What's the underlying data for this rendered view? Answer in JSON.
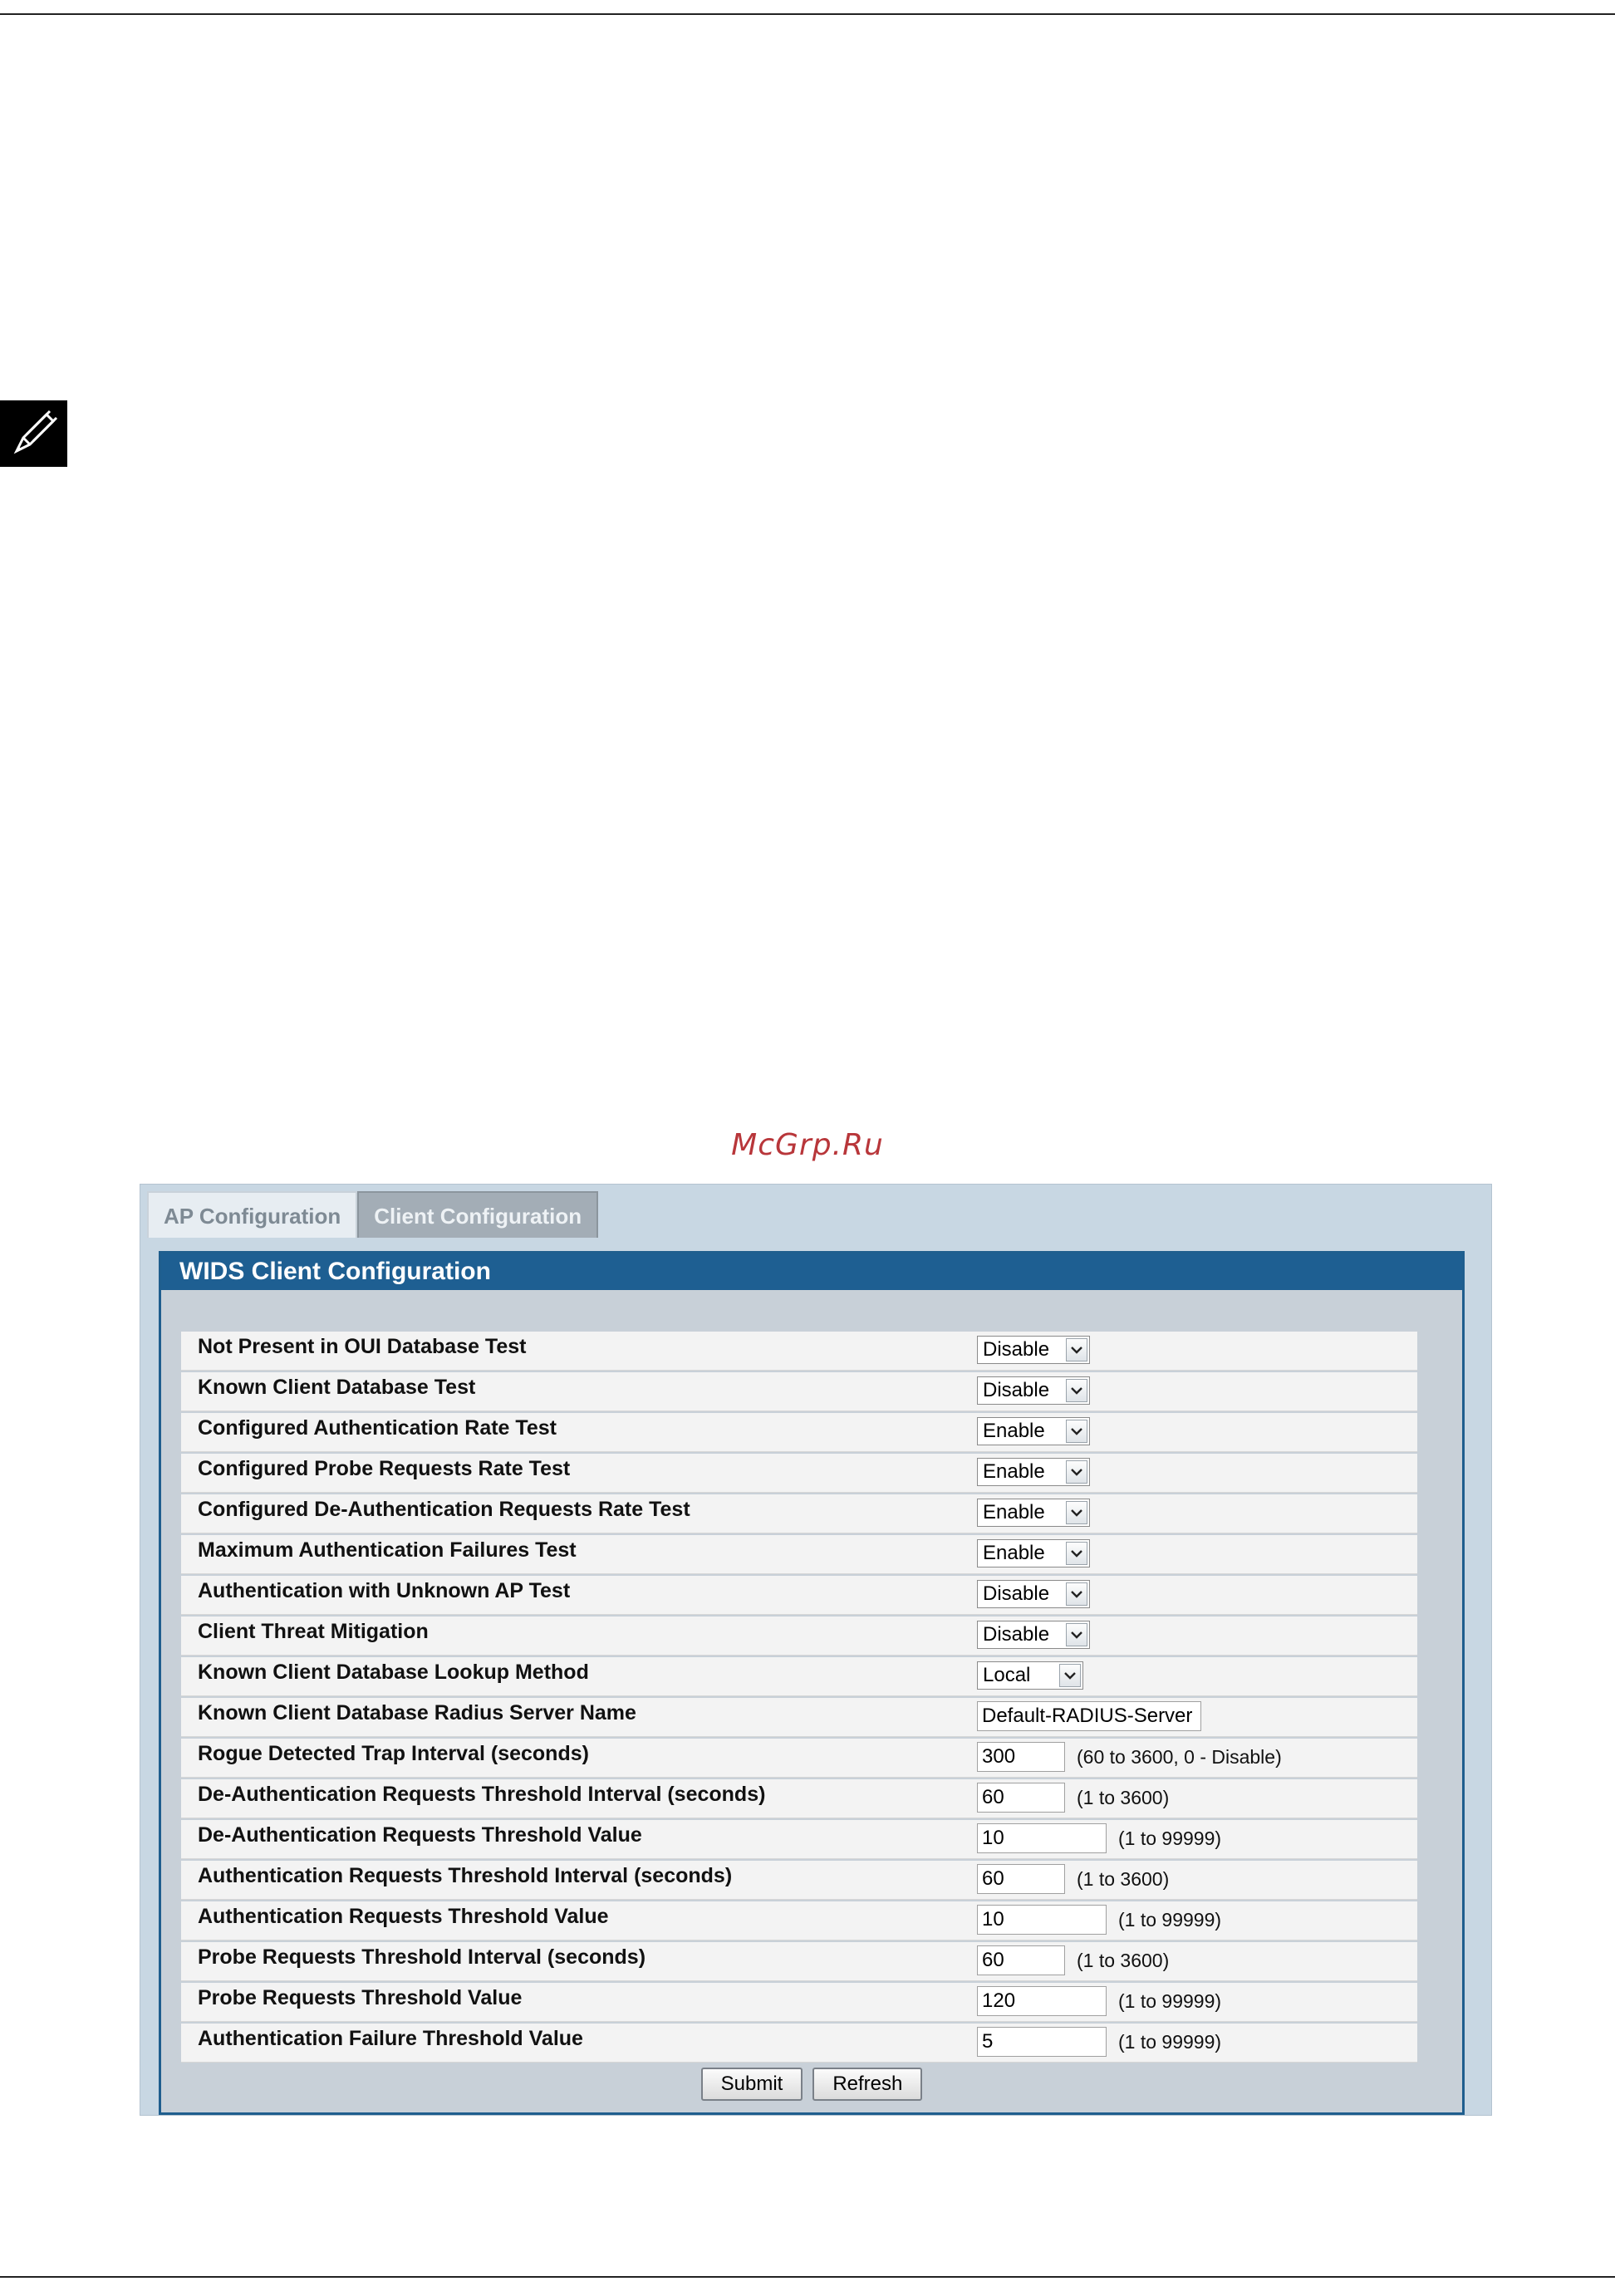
{
  "watermark": "McGrp.Ru",
  "tabs": [
    {
      "label": "AP Configuration",
      "active": false
    },
    {
      "label": "Client Configuration",
      "active": true
    }
  ],
  "panel": {
    "title": "WIDS Client Configuration",
    "rows": [
      {
        "label": "Not Present in OUI Database Test",
        "type": "select",
        "value": "Disable"
      },
      {
        "label": "Known Client Database Test",
        "type": "select",
        "value": "Disable"
      },
      {
        "label": "Configured Authentication Rate Test",
        "type": "select",
        "value": "Enable"
      },
      {
        "label": "Configured Probe Requests Rate Test",
        "type": "select",
        "value": "Enable"
      },
      {
        "label": "Configured De-Authentication Requests Rate Test",
        "type": "select",
        "value": "Enable"
      },
      {
        "label": "Maximum Authentication Failures Test",
        "type": "select",
        "value": "Enable"
      },
      {
        "label": "Authentication with Unknown AP Test",
        "type": "select",
        "value": "Disable"
      },
      {
        "label": "Client Threat Mitigation",
        "type": "select",
        "value": "Disable"
      },
      {
        "label": "Known Client Database Lookup Method",
        "type": "select",
        "value": "Local"
      },
      {
        "label": "Known Client Database Radius Server Name",
        "type": "text",
        "value": "Default-RADIUS-Server",
        "hint": ""
      },
      {
        "label": "Rogue Detected Trap Interval (seconds)",
        "type": "text",
        "value": "300",
        "hint": "(60 to 3600, 0 - Disable)"
      },
      {
        "label": "De-Authentication Requests Threshold Interval (seconds)",
        "type": "text",
        "value": "60",
        "hint": "(1 to 3600)"
      },
      {
        "label": "De-Authentication Requests Threshold Value",
        "type": "text",
        "value": "10",
        "hint": "(1 to 99999)"
      },
      {
        "label": "Authentication Requests Threshold Interval (seconds)",
        "type": "text",
        "value": "60",
        "hint": "(1 to 3600)"
      },
      {
        "label": "Authentication Requests Threshold Value",
        "type": "text",
        "value": "10",
        "hint": "(1 to 99999)"
      },
      {
        "label": "Probe Requests Threshold Interval (seconds)",
        "type": "text",
        "value": "60",
        "hint": "(1 to 3600)"
      },
      {
        "label": "Probe Requests Threshold Value",
        "type": "text",
        "value": "120",
        "hint": "(1 to 99999)"
      },
      {
        "label": "Authentication Failure Threshold Value",
        "type": "text",
        "value": "5",
        "hint": "(1 to 99999)"
      }
    ]
  },
  "buttons": {
    "submit": "Submit",
    "refresh": "Refresh"
  }
}
